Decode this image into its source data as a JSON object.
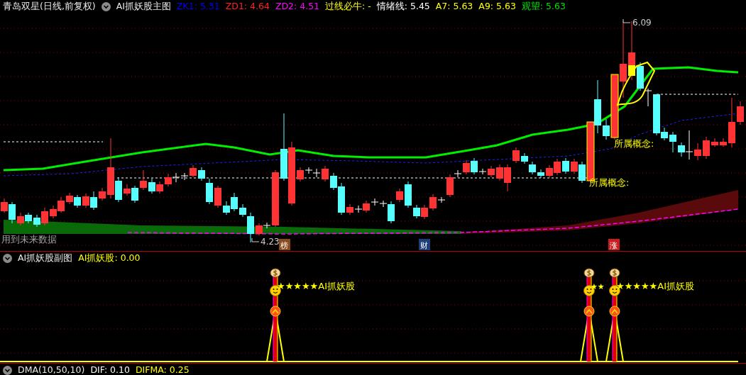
{
  "main_header": {
    "title": "青岛双星(日线,前复权)",
    "indicator_name": "AI抓妖股主图",
    "values": [
      {
        "text": "ZK1: 5.31",
        "color": "#0000ff"
      },
      {
        "text": "ZD1: 4.64",
        "color": "#ff2020"
      },
      {
        "text": "ZD2: 4.51",
        "color": "#ff00ff"
      },
      {
        "text": "过线必牛: -",
        "color": "#ffff00"
      },
      {
        "text": "情绪线: 5.45",
        "color": "#ffffff"
      },
      {
        "text": "A7: 5.63",
        "color": "#ffff00"
      },
      {
        "text": "A9: 5.63",
        "color": "#ffff00"
      },
      {
        "text": "观望: 5.63",
        "color": "#00e000"
      }
    ]
  },
  "main_chart": {
    "high_label": "6.09",
    "low_label": "4.23",
    "notes": [
      "所属概念:",
      "所属概念:"
    ],
    "future_data_notice": "用到未来数据",
    "event_badges": [
      {
        "text": "榜",
        "color": "#8b4a1c"
      },
      {
        "text": "财",
        "color": "#1c3f7a"
      },
      {
        "text": "涨",
        "color": "#c81e1e"
      }
    ]
  },
  "sub_header": {
    "indicator_name": "AI抓妖股副图",
    "values": [
      {
        "text": "AI抓妖股: 0.00",
        "color": "#ffff00"
      }
    ]
  },
  "sub_chart": {
    "signals": [
      {
        "label": "★★★★★AI抓妖股"
      },
      {
        "label": "★★"
      },
      {
        "label": "★★★★★AI抓妖股"
      }
    ]
  },
  "bottom_header": {
    "indicator_name": "DMA(10,50,10)",
    "values": [
      {
        "text": "DIF: 0.10",
        "color": "#ffffff"
      },
      {
        "text": "DIFMA: 0.25",
        "color": "#ffff00"
      }
    ]
  }
}
